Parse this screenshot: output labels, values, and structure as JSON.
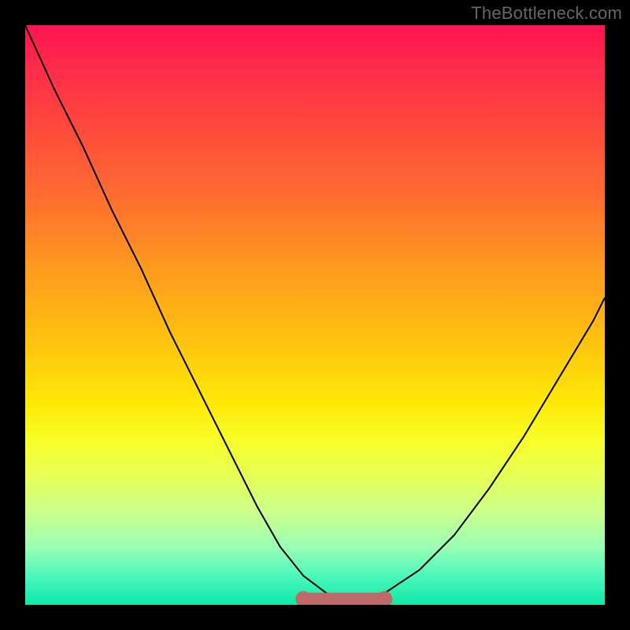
{
  "watermark": "TheBottleneck.com",
  "chart_data": {
    "type": "line",
    "title": "",
    "xlabel": "",
    "ylabel": "",
    "xlim": [
      0,
      100
    ],
    "ylim": [
      0,
      100
    ],
    "grid": false,
    "legend": false,
    "background": "rainbow-vertical-gradient",
    "series": [
      {
        "name": "bottleneck-curve",
        "x": [
          0,
          5,
          10,
          15,
          20,
          25,
          30,
          35,
          40,
          44,
          48,
          52,
          56,
          59,
          62,
          68,
          74,
          80,
          86,
          92,
          98,
          100
        ],
        "y": [
          100,
          89,
          79,
          68,
          58,
          47,
          37,
          27,
          17,
          10,
          5,
          2,
          1,
          1,
          2,
          6,
          12,
          20,
          29,
          39,
          49,
          53
        ]
      }
    ],
    "highlight": {
      "name": "minimum-plateau",
      "x_start": 48,
      "x_end": 62,
      "y": 1,
      "color": "#bf6a6a"
    },
    "gradient_stops": [
      {
        "pos": 0,
        "color": "#ff1450"
      },
      {
        "pos": 8,
        "color": "#ff2d4a"
      },
      {
        "pos": 18,
        "color": "#ff4a3c"
      },
      {
        "pos": 30,
        "color": "#ff6e2e"
      },
      {
        "pos": 42,
        "color": "#ff9a1e"
      },
      {
        "pos": 55,
        "color": "#ffc40e"
      },
      {
        "pos": 65,
        "color": "#ffe806"
      },
      {
        "pos": 72,
        "color": "#f7ff2a"
      },
      {
        "pos": 78,
        "color": "#e5ff58"
      },
      {
        "pos": 84,
        "color": "#ccff8c"
      },
      {
        "pos": 90,
        "color": "#9affb4"
      },
      {
        "pos": 95,
        "color": "#4cf7bd"
      },
      {
        "pos": 100,
        "color": "#0ee9a5"
      }
    ]
  }
}
